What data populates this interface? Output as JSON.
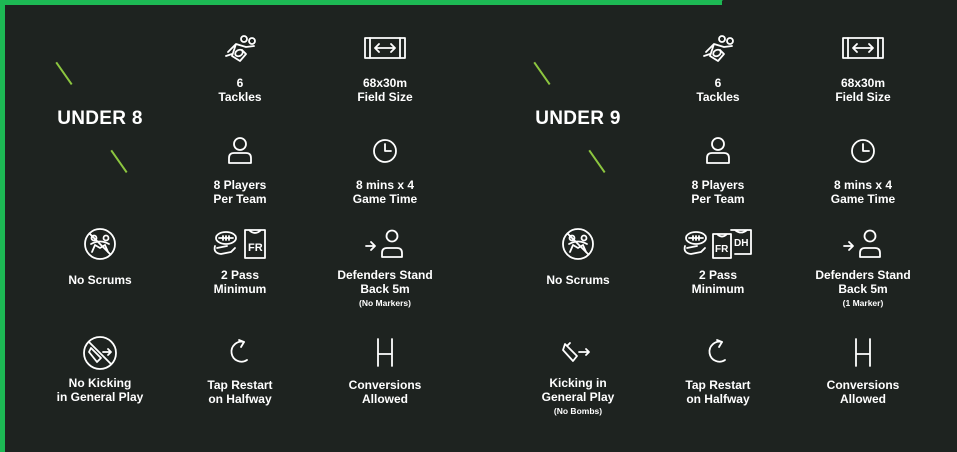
{
  "accent_color": "#1db954",
  "slash_color": "#8cc63f",
  "background_color": "#1e2320",
  "panels": [
    {
      "title": "UNDER 8",
      "tackles": {
        "icon": "tackle-icon",
        "line1": "6",
        "line2": "Tackles"
      },
      "field": {
        "icon": "field-size-icon",
        "line1": "68x30m",
        "line2": "Field Size"
      },
      "players": {
        "icon": "person-icon",
        "line1": "8 Players",
        "line2": "Per Team"
      },
      "time": {
        "icon": "clock-icon",
        "line1": "8 mins x 4",
        "line2": "Game Time"
      },
      "scrums": {
        "icon": "no-scrums-icon",
        "line1": "No Scrums"
      },
      "pass": {
        "icon": "pass-fr-icon",
        "line1": "2 Pass",
        "line2": "Minimum"
      },
      "defenders": {
        "icon": "defenders-icon",
        "line1": "Defenders Stand",
        "line2": "Back 5m",
        "note": "(No Markers)"
      },
      "kicking": {
        "icon": "no-kicking-icon",
        "line1": "No Kicking",
        "line2": "in General Play",
        "note": ""
      },
      "restart": {
        "icon": "tap-restart-icon",
        "line1": "Tap Restart",
        "line2": "on Halfway"
      },
      "conversions": {
        "icon": "goalpost-icon",
        "line1": "Conversions",
        "line2": "Allowed"
      }
    },
    {
      "title": "UNDER 9",
      "tackles": {
        "icon": "tackle-icon",
        "line1": "6",
        "line2": "Tackles"
      },
      "field": {
        "icon": "field-size-icon",
        "line1": "68x30m",
        "line2": "Field Size"
      },
      "players": {
        "icon": "person-icon",
        "line1": "8 Players",
        "line2": "Per Team"
      },
      "time": {
        "icon": "clock-icon",
        "line1": "8 mins x 4",
        "line2": "Game Time"
      },
      "scrums": {
        "icon": "no-scrums-icon",
        "line1": "No Scrums"
      },
      "pass": {
        "icon": "pass-fr-dh-icon",
        "line1": "2 Pass",
        "line2": "Minimum"
      },
      "defenders": {
        "icon": "defenders-icon",
        "line1": "Defenders Stand",
        "line2": "Back 5m",
        "note": "(1 Marker)"
      },
      "kicking": {
        "icon": "kicking-icon",
        "line1": "Kicking in",
        "line2": "General Play",
        "note": "(No Bombs)"
      },
      "restart": {
        "icon": "tap-restart-icon",
        "line1": "Tap Restart",
        "line2": "on Halfway"
      },
      "conversions": {
        "icon": "goalpost-icon",
        "line1": "Conversions",
        "line2": "Allowed"
      }
    }
  ]
}
